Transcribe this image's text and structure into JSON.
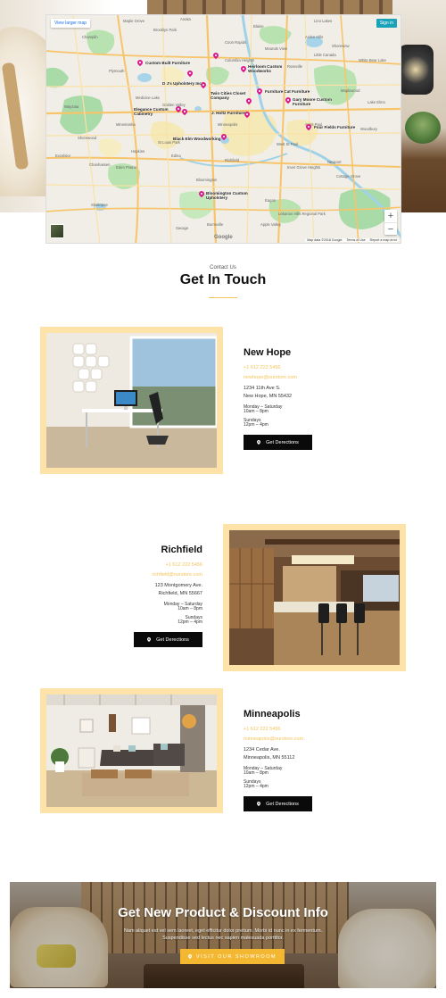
{
  "map": {
    "view_larger_label": "View larger map",
    "sign_in_label": "Sign in",
    "zoom_in_label": "+",
    "zoom_out_label": "−",
    "footer": [
      "Map data ©2018 Google",
      "Terms of Use",
      "Report a map error"
    ],
    "logo": "Google",
    "towns": [
      "Maple Grove",
      "Brooklyn Park",
      "Blaine",
      "Lino Lakes",
      "Champlin",
      "Anoka",
      "Coon Rapids",
      "Mounds View",
      "Arden Hills",
      "Shoreview",
      "Columbia Heights",
      "Roseville",
      "Little Canada",
      "White Bear Lake",
      "Maplewood",
      "Plymouth",
      "Medicine Lake",
      "Golden Valley",
      "Minneapolis",
      "Saint Paul",
      "Wayzata",
      "Minnetonka",
      "St Louis Park",
      "Edina",
      "Richfield",
      "Hopkins",
      "Shorewood",
      "Excelsior",
      "Chanhassen",
      "Eden Prairie",
      "Bloomington",
      "Burnsville",
      "Eagan",
      "Savage",
      "Shakopee",
      "Woodbury",
      "Cottage Grove",
      "Inver Grove Heights",
      "Apple Valley",
      "West St Paul",
      "Lebanon Hills Regional Park",
      "Newport",
      "Lake Elmo"
    ],
    "markers": [
      {
        "label": "Custom Built Furniture"
      },
      {
        "label": "Heirloom Custom Woodworks"
      },
      {
        "label": "D J's Upholstery Inc"
      },
      {
        "label": "Furniture Cat Furniture"
      },
      {
        "label": "Twin Cities Closet Company"
      },
      {
        "label": "Gary Moore Custom Furniture"
      },
      {
        "label": "Elegance Custom Cabinetry"
      },
      {
        "label": "J. Holtz Furniture"
      },
      {
        "label": "Four Fields Furniture"
      },
      {
        "label": "Black Elm Woodworking"
      },
      {
        "label": "Bloomington Custom Upholstery"
      },
      {
        "label": ""
      },
      {
        "label": ""
      },
      {
        "label": ""
      }
    ]
  },
  "contact": {
    "eyebrow": "Contact Us",
    "title": "Get In Touch"
  },
  "locations": [
    {
      "name": "New Hope",
      "phone": "+1 612 222 5456",
      "email": "newhope@ourstore.com",
      "address_line1": "1234 11th Ave S.",
      "address_line2": "New Hope, MN 55432",
      "hours_weekday_label": "Monday – Saturday",
      "hours_weekday": "10am – 8pm",
      "hours_sunday_label": "Sundays",
      "hours_sunday": "12pm – 4pm",
      "button_label": "Get Derections"
    },
    {
      "name": "Richfield",
      "phone": "+1 612 222 5456",
      "email": "richfield@ourstore.com",
      "address_line1": "123 Montgomery Ave.",
      "address_line2": "Richfield, MN 55667",
      "hours_weekday_label": "Monday – Saturday",
      "hours_weekday": "10am – 8pm",
      "hours_sunday_label": "Sundays",
      "hours_sunday": "12pm – 4pm",
      "button_label": "Get Derections"
    },
    {
      "name": "Minneapolis",
      "phone": "+1 612 222 5456",
      "email": "minneapolis@ourstore.com",
      "address_line1": "1234 Cedar Ave.",
      "address_line2": "Minneapolis, MN 55112",
      "hours_weekday_label": "Monday – Saturday",
      "hours_weekday": "10am – 8pm",
      "hours_sunday_label": "Sundays",
      "hours_sunday": "12pm – 4pm",
      "button_label": "Get Derections"
    }
  ],
  "banner": {
    "title": "Get New Product & Discount Info",
    "body": "Nam aliquet est vel sem laoreet, eget efficitur dolor pretium. Morbi id nunc in ex fermentum. Suspendisse sed lectus nec sapien malesuada porttitor.",
    "cta_label": "VISIT OUR SHOWROOM"
  },
  "colors": {
    "accent_yellow": "#f3b731",
    "frame_cream": "#fde3a8",
    "marker_magenta": "#d81b8c",
    "button_black": "#0a0a0a",
    "map_signin_teal": "#1aa3b8"
  }
}
